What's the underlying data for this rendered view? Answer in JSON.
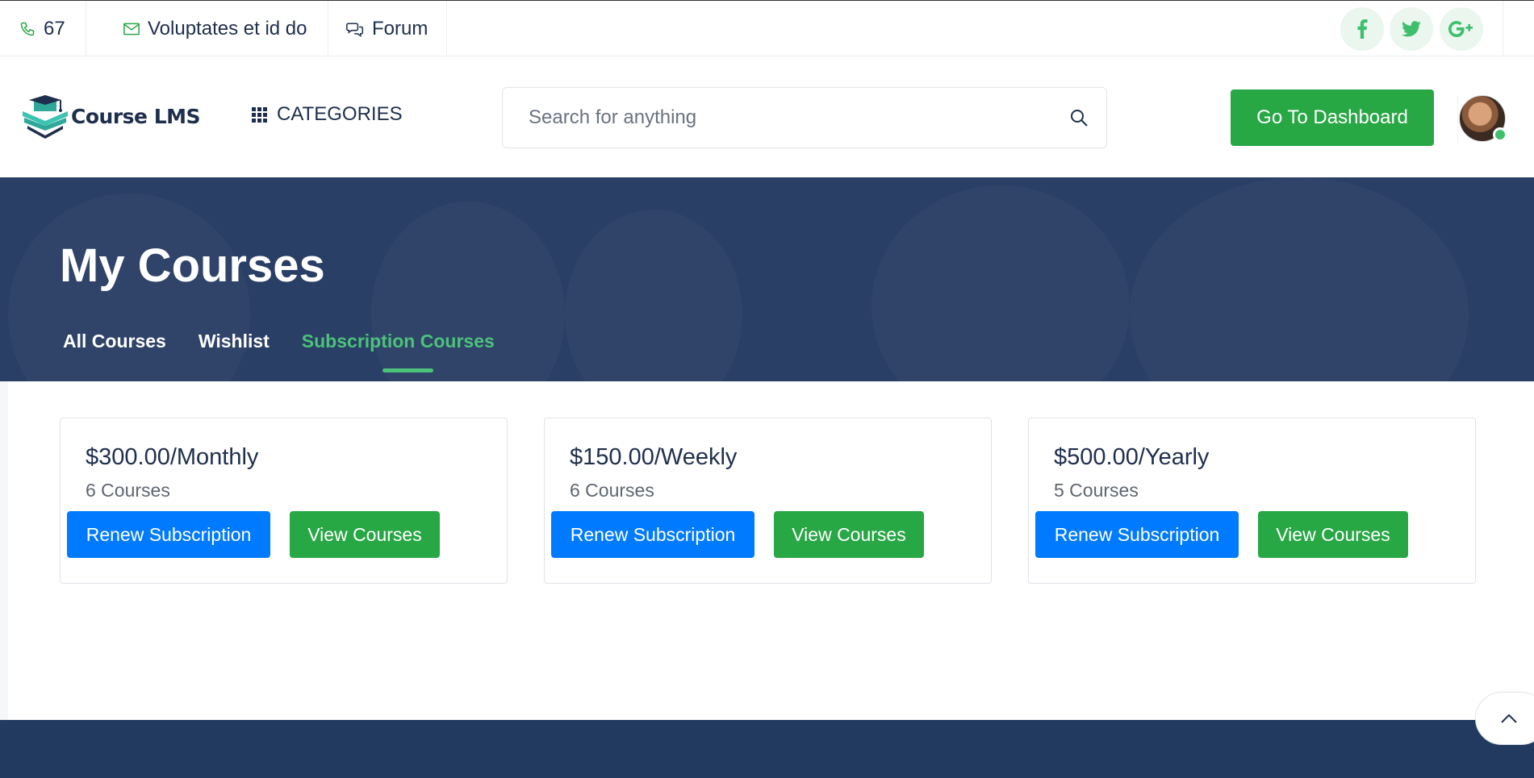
{
  "topbar": {
    "phone": "67",
    "email": "Voluptates et id do",
    "forum": "Forum",
    "social": [
      "facebook-icon",
      "twitter-icon",
      "google-plus-icon"
    ]
  },
  "header": {
    "logo_text": "Course LMS",
    "categories_label": "CATEGORIES",
    "search_placeholder": "Search for anything",
    "dashboard_button": "Go To Dashboard"
  },
  "hero": {
    "title": "My Courses",
    "tabs": [
      {
        "label": "All Courses",
        "active": false
      },
      {
        "label": "Wishlist",
        "active": false
      },
      {
        "label": "Subscription Courses",
        "active": true
      }
    ]
  },
  "subscriptions": [
    {
      "price": "$300.00/Monthly",
      "courses": "6 Courses",
      "renew_label": "Renew Subscription",
      "view_label": "View Courses"
    },
    {
      "price": "$150.00/Weekly",
      "courses": "6 Courses",
      "renew_label": "Renew Subscription",
      "view_label": "View Courses"
    },
    {
      "price": "$500.00/Yearly",
      "courses": "5 Courses",
      "renew_label": "Renew Subscription",
      "view_label": "View Courses"
    }
  ],
  "colors": {
    "navy": "#1e2f4d",
    "hero_bg": "#2a3f66",
    "accent_green": "#28a745",
    "tab_active": "#4cc27a",
    "primary_blue": "#007bff",
    "footer_bg": "#223a60"
  }
}
